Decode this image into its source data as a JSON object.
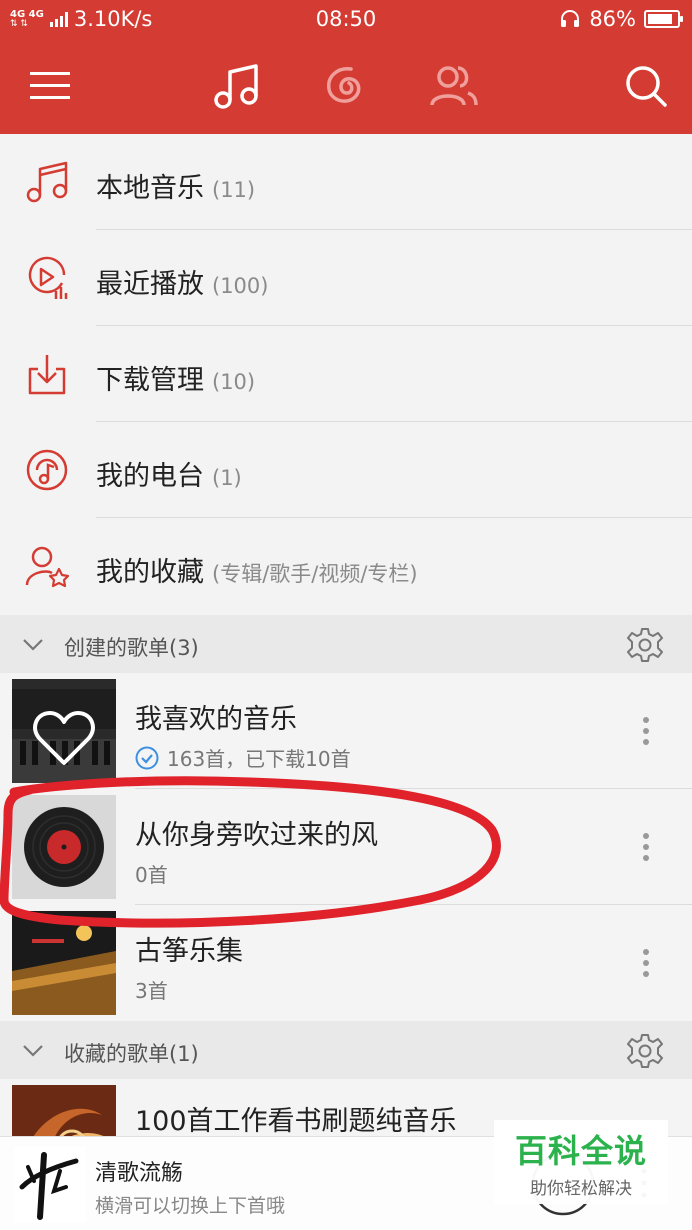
{
  "status_bar": {
    "network_label": "4G 4G",
    "speed": "3.10K/s",
    "time": "08:50",
    "battery": "86%",
    "battery_level": 0.86
  },
  "top_nav": {
    "icons": [
      "menu-icon",
      "music-note-icon",
      "netease-cloud-icon",
      "friends-icon",
      "search-icon"
    ],
    "active": "music-note-icon"
  },
  "menu": [
    {
      "label": "本地音乐",
      "count": "(11)",
      "icon": "music-note-icon"
    },
    {
      "label": "最近播放",
      "count": "(100)",
      "icon": "recent-play-icon"
    },
    {
      "label": "下载管理",
      "count": "(10)",
      "icon": "download-icon"
    },
    {
      "label": "我的电台",
      "count": "(1)",
      "icon": "radio-icon"
    },
    {
      "label": "我的收藏",
      "count": "(专辑/歌手/视频/专栏)",
      "icon": "user-star-icon"
    }
  ],
  "created_section": {
    "label": "创建的歌单(3)",
    "playlists": [
      {
        "title": "我喜欢的音乐",
        "sub": "163首，已下载10首"
      },
      {
        "title": "从你身旁吹过来的风",
        "sub": "0首"
      },
      {
        "title": "古筝乐集",
        "sub": "3首"
      }
    ]
  },
  "collected_section": {
    "label": "收藏的歌单(1)",
    "playlists": [
      {
        "title": "100首工作看书刷题纯音乐"
      }
    ]
  },
  "player": {
    "title": "清歌流觞",
    "subtitle": "横滑可以切换上下首哦"
  },
  "watermark": {
    "main": "百科全说",
    "sub": "助你轻松解决"
  },
  "colors": {
    "brand_red": "#d43c33",
    "annotation_red": "#e0232b",
    "check_blue": "#3d8fe0"
  }
}
